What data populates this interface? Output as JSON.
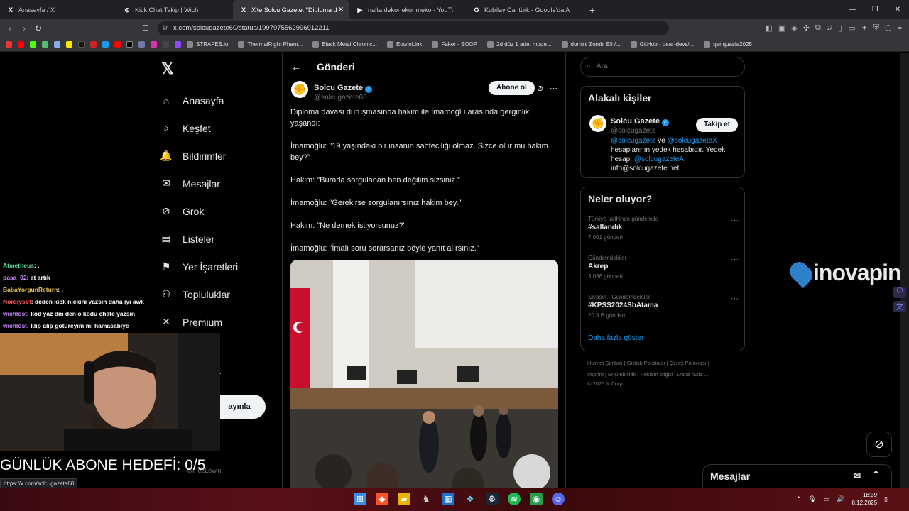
{
  "tabs": [
    {
      "icon": "X",
      "label": "Anasayfa / X",
      "active": false
    },
    {
      "icon": "⊙",
      "label": "Kick Chat Takip | Wich",
      "active": false
    },
    {
      "icon": "X",
      "label": "X'te Solcu Gazete: \"Diploma dav",
      "active": true
    },
    {
      "icon": "▶",
      "label": "nafta dekor ekor meko - YouTube",
      "active": false
    },
    {
      "icon": "G",
      "label": "Kubilay Cantürk - Google'da Ara",
      "active": false
    }
  ],
  "url": "x.com/solcugazete60/status/1997975562996912211",
  "bookmarks": [
    "STRAFES.io",
    "ThermalRight Phant...",
    "Black Metal Chronic...",
    "EowinLink",
    "Faker - SOOP",
    "2d düz 1 adet mode...",
    "domini Zombi Eli /...",
    "GitHub - pear-devs/...",
    "qanquasia2025"
  ],
  "nav": {
    "items": [
      {
        "icon": "⌂",
        "label": "Anasayfa"
      },
      {
        "icon": "⌕",
        "label": "Keşfet"
      },
      {
        "icon": "🔔",
        "label": "Bildirimler"
      },
      {
        "icon": "✉",
        "label": "Mesajlar"
      },
      {
        "icon": "⊘",
        "label": "Grok"
      },
      {
        "icon": "▤",
        "label": "Listeler"
      },
      {
        "icon": "⚑",
        "label": "Yer İşaretleri"
      },
      {
        "icon": "⚇",
        "label": "Topluluklar"
      },
      {
        "icon": "✕",
        "label": "Premium"
      }
    ],
    "profile_partial": "la",
    "post_button": "ayınla",
    "handle_partial": "@FiezLowin"
  },
  "post": {
    "header": "Gönderi",
    "author_name": "Solcu Gazete",
    "author_handle": "@solcugazete60",
    "subscribe": "Abone ol",
    "paragraphs": [
      "Diploma davası duruşmasında hakim ile İmamoğlu arasında gerginlik yaşandı:",
      "İmamoğlu: \"19 yaşındaki bir insanın sahteciliği olmaz. Sizce olur mu hakim bey?\"",
      "Hakim: \"Burada sorgulanan ben değilim sizsiniz.\"",
      "İmamoğlu: \"Gerekirse sorgulanırsınız hakim bey.\"",
      "Hakim: \"Ne demek istiyorsunuz?\"",
      "İmamoğlu: \"İmalı soru sorarsanız böyle yanıt alırsınız.\""
    ]
  },
  "right": {
    "search_placeholder": "Ara",
    "related_title": "Alakalı kişiler",
    "related_name": "Solcu Gazete",
    "related_handle": "@solcugazete",
    "follow": "Takip et",
    "bio_link1": "@solcugazete",
    "bio_ve": " ve ",
    "bio_link2": "@solcugazeteX",
    "bio_text": "hesaplarının yedek hesabıdır. Yedek hesap: ",
    "bio_link3": "@solcugazeteA",
    "bio_email": "info@solcugazete.net",
    "trends_title": "Neler oluyor?",
    "trends": [
      {
        "context": "Türkiye tarihinde gündemde",
        "name": "#sallandık",
        "count": "7.001 gönderi"
      },
      {
        "context": "Gündemdekiler",
        "name": "Akrep",
        "count": "3.056 gönderi"
      },
      {
        "context": "Siyaset · Gündemdekiler",
        "name": "#KPSS2024SbAtama",
        "count": "20,9 B gönderi"
      }
    ],
    "show_more": "Daha fazla göster",
    "footer_line1": "Hizmet Şartları  |  Gizlilik Politikası  |  Çerez Politikası  |",
    "footer_line2": "Imprint  |  Erişilebilirlik  |  Reklam bilgisi  |  Daha fazla ...",
    "footer_line3": "© 2025 X Corp.",
    "messages": "Mesajlar"
  },
  "overlay": {
    "chat": [
      {
        "user": "Atmetheus",
        "color": "#5fd7a0",
        "msg": ": ."
      },
      {
        "user": "pasa_02",
        "color": "#c98bff",
        "msg": ": at artık"
      },
      {
        "user": "BabaYorgunReturn",
        "color": "#e0c060",
        "msg": ": ."
      },
      {
        "user": "NordiysVI",
        "color": "#ff5a5a",
        "msg": ": dcden kick nickini yazsın daha iyi awk"
      },
      {
        "user": "wichlost",
        "color": "#c98bff",
        "msg": ": kod yaz dm den o kodu chate yazsın"
      },
      {
        "user": "wichlost",
        "color": "#c98bff",
        "msg": ": klip alıp götüreyim mi hamasabiye"
      }
    ],
    "goal": "GÜNLÜK ABONE HEDEFİ: 0/5",
    "status_url": "https://x.com/solcugazete60",
    "sponsor": "inovapin"
  },
  "taskbar": {
    "time": "18:39",
    "date": "8.12.2025"
  }
}
